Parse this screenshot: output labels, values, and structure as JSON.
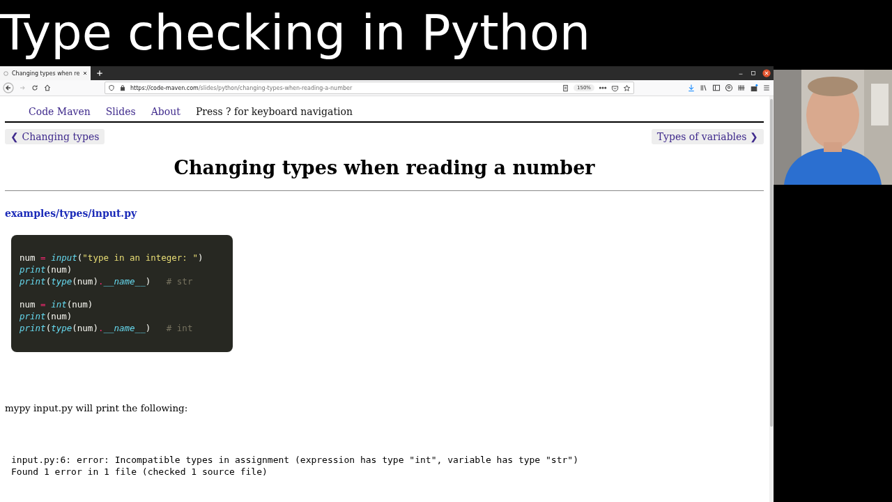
{
  "banner": {
    "title": "Type checking in Python"
  },
  "browser": {
    "tab": {
      "title": "Changing types when re",
      "selected": true
    },
    "url": {
      "host": "https://code-maven.com",
      "path": "/slides/python/changing-types-when-reading-a-number"
    },
    "zoom": "150%"
  },
  "page": {
    "nav": [
      {
        "label": "Code Maven",
        "kind": "link"
      },
      {
        "label": "Slides",
        "kind": "link"
      },
      {
        "label": "About",
        "kind": "link"
      },
      {
        "label": "Press ? for keyboard navigation",
        "kind": "text"
      }
    ],
    "prev": "❮ Changing types",
    "next": "Types of variables ❯",
    "heading": "Changing types when reading a number",
    "file_link": "examples/types/input.py",
    "code": [
      [
        [
          {
            "text": "num ",
            "kind": "plain"
          },
          {
            "text": "= ",
            "kind": "op"
          },
          {
            "text": "input",
            "kind": "fn"
          },
          {
            "text": "(",
            "kind": "plain"
          },
          {
            "text": "\"type in an integer: \"",
            "kind": "str"
          },
          {
            "text": ")",
            "kind": "plain"
          }
        ],
        [
          {
            "text": "print",
            "kind": "fn"
          },
          {
            "text": "(num)",
            "kind": "plain"
          }
        ],
        [
          {
            "text": "print",
            "kind": "fn"
          },
          {
            "text": "(",
            "kind": "plain"
          },
          {
            "text": "type",
            "kind": "fn"
          },
          {
            "text": "(num)",
            "kind": "plain"
          },
          {
            "text": ".",
            "kind": "op"
          },
          {
            "text": "__name__",
            "kind": "fn"
          },
          {
            "text": ")   ",
            "kind": "plain"
          },
          {
            "text": "# str",
            "kind": "comment"
          }
        ]
      ],
      [
        [
          {
            "text": "num ",
            "kind": "plain"
          },
          {
            "text": "= ",
            "kind": "op"
          },
          {
            "text": "int",
            "kind": "fn"
          },
          {
            "text": "(num)",
            "kind": "plain"
          }
        ],
        [
          {
            "text": "print",
            "kind": "fn"
          },
          {
            "text": "(num)",
            "kind": "plain"
          }
        ],
        [
          {
            "text": "print",
            "kind": "fn"
          },
          {
            "text": "(",
            "kind": "plain"
          },
          {
            "text": "type",
            "kind": "fn"
          },
          {
            "text": "(num)",
            "kind": "plain"
          },
          {
            "text": ".",
            "kind": "op"
          },
          {
            "text": "__name__",
            "kind": "fn"
          },
          {
            "text": ")   ",
            "kind": "plain"
          },
          {
            "text": "# int",
            "kind": "comment"
          }
        ]
      ]
    ],
    "note": "mypy input.py will print the following:",
    "output": [
      "input.py:6: error: Incompatible types in assignment (expression has type \"int\", variable has type \"str\")",
      "Found 1 error in 1 file (checked 1 source file)"
    ]
  }
}
